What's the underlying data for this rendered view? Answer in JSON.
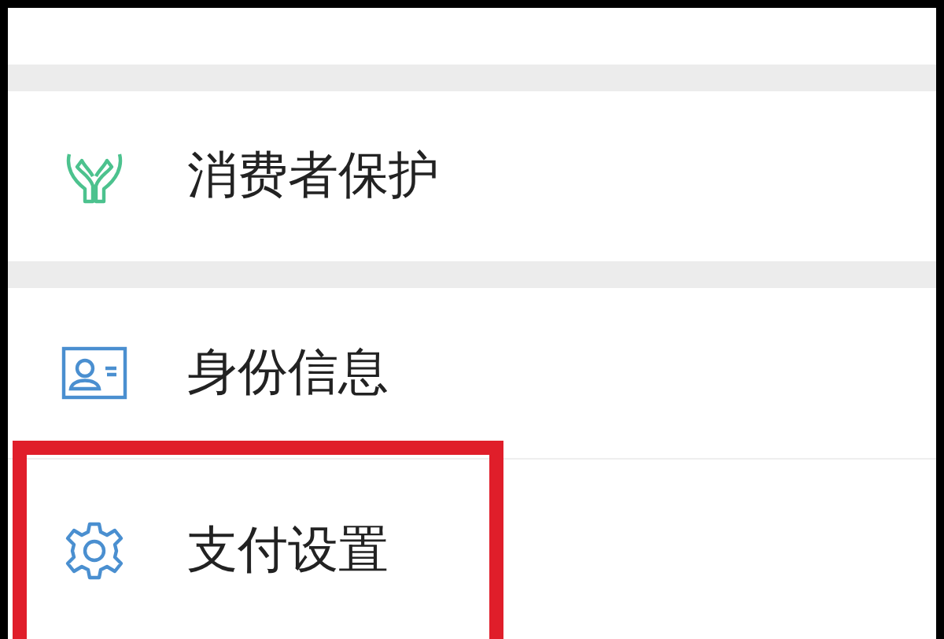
{
  "sections": [
    {
      "items": [
        {
          "label": "消费者保护",
          "highlighted": false
        }
      ]
    },
    {
      "items": [
        {
          "label": "身份信息",
          "highlighted": false
        },
        {
          "label": "支付设置",
          "highlighted": true
        }
      ]
    }
  ]
}
